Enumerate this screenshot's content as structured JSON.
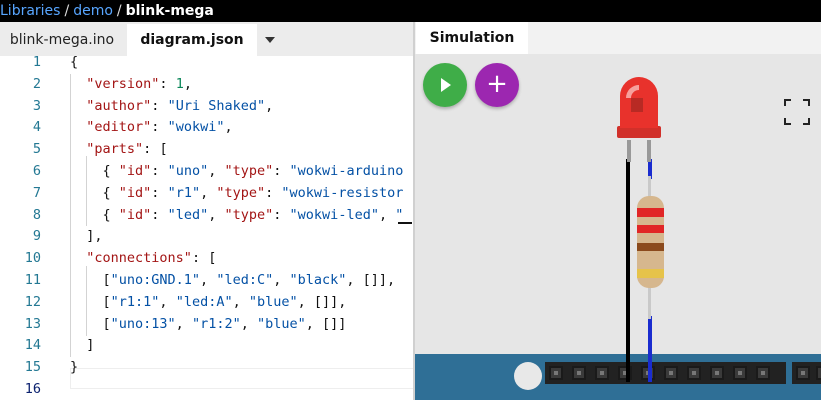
{
  "breadcrumb": {
    "items": [
      "Libraries",
      "demo"
    ],
    "separator": "/",
    "current": "blink-mega"
  },
  "editor": {
    "tabs": [
      {
        "label": "blink-mega.ino",
        "active": false
      },
      {
        "label": "diagram.json",
        "active": true
      }
    ],
    "tab_menu_icon": "caret-down-icon",
    "line_numbers": [
      "1",
      "2",
      "3",
      "4",
      "5",
      "6",
      "7",
      "8",
      "9",
      "10",
      "11",
      "12",
      "13",
      "14",
      "15",
      "16"
    ],
    "current_line": 16,
    "lines": [
      "{",
      "  \"version\": 1,",
      "  \"author\": \"Uri Shaked\",",
      "  \"editor\": \"wokwi\",",
      "  \"parts\": [",
      "    { \"id\": \"uno\", \"type\": \"wokwi-arduino",
      "    { \"id\": \"r1\", \"type\": \"wokwi-resistor",
      "    { \"id\": \"led\", \"type\": \"wokwi-led\", \"",
      "  ],",
      "  \"connections\": [",
      "    [\"uno:GND.1\", \"led:C\", \"black\", []],",
      "    [\"r1:1\", \"led:A\", \"blue\", []],",
      "    [\"uno:13\", \"r1:2\", \"blue\", []]",
      "  ]",
      "}",
      ""
    ]
  },
  "simulation": {
    "tab_label": "Simulation",
    "start_icon": "play-icon",
    "add_part_label": "+",
    "fullscreen_icon": "fullscreen-icon",
    "parts": [
      "led-red",
      "resistor",
      "arduino-board"
    ],
    "colors": {
      "start": "#3fad48",
      "add": "#9c27b0",
      "board": "#2f6f96",
      "wire_black": "#000000",
      "wire_blue": "#1a2ccf",
      "led": "#e8322c"
    }
  }
}
